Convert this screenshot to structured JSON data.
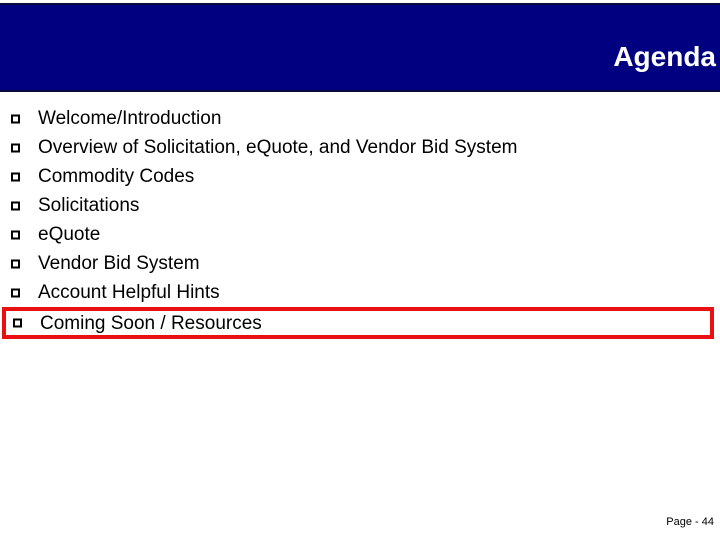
{
  "slide": {
    "title": "Agenda",
    "background_color": "#ffffff",
    "banner_color": "#000080",
    "title_color": "#ffffff",
    "highlight_color": "#e81010"
  },
  "agenda": {
    "bullet_icon": "hollow-square-bullet",
    "items": [
      {
        "label": "Welcome/Introduction",
        "highlighted": false
      },
      {
        "label": "Overview of Solicitation, eQuote, and Vendor Bid System",
        "highlighted": false
      },
      {
        "label": "Commodity Codes",
        "highlighted": false
      },
      {
        "label": "Solicitations",
        "highlighted": false
      },
      {
        "label": "eQuote",
        "highlighted": false
      },
      {
        "label": "Vendor Bid System",
        "highlighted": false
      },
      {
        "label": "Account Helpful Hints",
        "highlighted": false
      },
      {
        "label": "Coming Soon / Resources",
        "highlighted": true
      }
    ]
  },
  "footer": {
    "page_number": "Page - 44"
  }
}
